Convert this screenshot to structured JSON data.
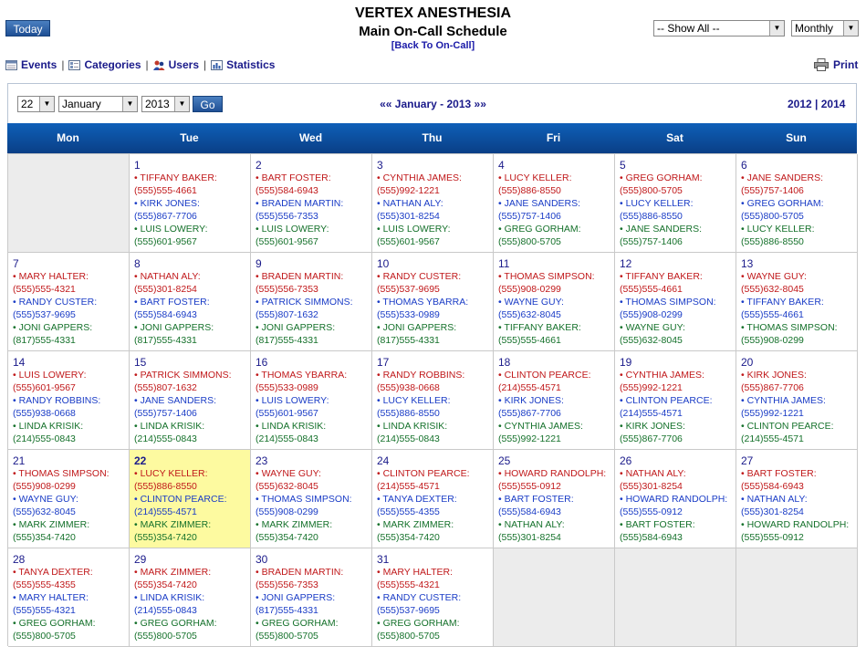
{
  "header": {
    "title": "VERTEX ANESTHESIA",
    "subtitle": "Main On-Call Schedule",
    "back_link": "[Back To On-Call]",
    "today_button": "Today",
    "show_filter": "-- Show All --",
    "view_mode": "Monthly"
  },
  "toolbar": {
    "events": "Events",
    "categories": "Categories",
    "users": "Users",
    "statistics": "Statistics",
    "print": "Print"
  },
  "nav": {
    "day": "22",
    "month": "January",
    "year": "2013",
    "go": "Go",
    "prev": "««",
    "month_label": "January - 2013",
    "next": "»»",
    "prev_year": "2012",
    "year_sep": "|",
    "next_year": "2014"
  },
  "weekdays": [
    "Mon",
    "Tue",
    "Wed",
    "Thu",
    "Fri",
    "Sat",
    "Sun"
  ],
  "colors": {
    "red": "#c0181a",
    "blue": "#1a3cc6",
    "green": "#15712b",
    "header": "#0e5fb8",
    "today": "#fdfaa0"
  },
  "weeks": [
    [
      null,
      {
        "day": "1",
        "entries": [
          [
            "• TIFFANY BAKER:",
            "(555)555-4661"
          ],
          [
            "• KIRK JONES:",
            "(555)867-7706"
          ],
          [
            "• LUIS LOWERY:",
            "(555)601-9567"
          ]
        ]
      },
      {
        "day": "2",
        "entries": [
          [
            "• BART FOSTER:",
            "(555)584-6943"
          ],
          [
            "• BRADEN MARTIN:",
            "(555)556-7353"
          ],
          [
            "• LUIS LOWERY:",
            "(555)601-9567"
          ]
        ]
      },
      {
        "day": "3",
        "entries": [
          [
            "• CYNTHIA JAMES:",
            "(555)992-1221"
          ],
          [
            "• NATHAN ALY:",
            "(555)301-8254"
          ],
          [
            "• LUIS LOWERY:",
            "(555)601-9567"
          ]
        ]
      },
      {
        "day": "4",
        "entries": [
          [
            "• LUCY KELLER:",
            "(555)886-8550"
          ],
          [
            "• JANE SANDERS:",
            "(555)757-1406"
          ],
          [
            "• GREG GORHAM:",
            "(555)800-5705"
          ]
        ]
      },
      {
        "day": "5",
        "entries": [
          [
            "• GREG GORHAM:",
            "(555)800-5705"
          ],
          [
            "• LUCY KELLER:",
            "(555)886-8550"
          ],
          [
            "• JANE SANDERS:",
            "(555)757-1406"
          ]
        ]
      },
      {
        "day": "6",
        "entries": [
          [
            "• JANE SANDERS:",
            "(555)757-1406"
          ],
          [
            "• GREG GORHAM:",
            "(555)800-5705"
          ],
          [
            "• LUCY KELLER:",
            "(555)886-8550"
          ]
        ]
      }
    ],
    [
      {
        "day": "7",
        "entries": [
          [
            "• MARY HALTER:",
            "(555)555-4321"
          ],
          [
            "• RANDY CUSTER:",
            "(555)537-9695"
          ],
          [
            "• JONI GAPPERS:",
            "(817)555-4331"
          ]
        ]
      },
      {
        "day": "8",
        "entries": [
          [
            "• NATHAN ALY:",
            "(555)301-8254"
          ],
          [
            "• BART FOSTER:",
            "(555)584-6943"
          ],
          [
            "• JONI GAPPERS:",
            "(817)555-4331"
          ]
        ]
      },
      {
        "day": "9",
        "entries": [
          [
            "• BRADEN MARTIN:",
            "(555)556-7353"
          ],
          [
            "• PATRICK SIMMONS:",
            "(555)807-1632"
          ],
          [
            "• JONI GAPPERS:",
            "(817)555-4331"
          ]
        ]
      },
      {
        "day": "10",
        "entries": [
          [
            "• RANDY CUSTER:",
            "(555)537-9695"
          ],
          [
            "• THOMAS YBARRA:",
            "(555)533-0989"
          ],
          [
            "• JONI GAPPERS:",
            "(817)555-4331"
          ]
        ]
      },
      {
        "day": "11",
        "entries": [
          [
            "• THOMAS SIMPSON:",
            "(555)908-0299"
          ],
          [
            "• WAYNE GUY:",
            "(555)632-8045"
          ],
          [
            "• TIFFANY BAKER:",
            "(555)555-4661"
          ]
        ]
      },
      {
        "day": "12",
        "entries": [
          [
            "• TIFFANY BAKER:",
            "(555)555-4661"
          ],
          [
            "• THOMAS SIMPSON:",
            "(555)908-0299"
          ],
          [
            "• WAYNE GUY:",
            "(555)632-8045"
          ]
        ]
      },
      {
        "day": "13",
        "entries": [
          [
            "• WAYNE GUY:",
            "(555)632-8045"
          ],
          [
            "• TIFFANY BAKER:",
            "(555)555-4661"
          ],
          [
            "• THOMAS SIMPSON:",
            "(555)908-0299"
          ]
        ]
      }
    ],
    [
      {
        "day": "14",
        "entries": [
          [
            "• LUIS LOWERY:",
            "(555)601-9567"
          ],
          [
            "• RANDY ROBBINS:",
            "(555)938-0668"
          ],
          [
            "• LINDA KRISIK:",
            "(214)555-0843"
          ]
        ]
      },
      {
        "day": "15",
        "entries": [
          [
            "• PATRICK SIMMONS:",
            "(555)807-1632"
          ],
          [
            "• JANE SANDERS:",
            "(555)757-1406"
          ],
          [
            "• LINDA KRISIK:",
            "(214)555-0843"
          ]
        ]
      },
      {
        "day": "16",
        "entries": [
          [
            "• THOMAS YBARRA:",
            "(555)533-0989"
          ],
          [
            "• LUIS LOWERY:",
            "(555)601-9567"
          ],
          [
            "• LINDA KRISIK:",
            "(214)555-0843"
          ]
        ]
      },
      {
        "day": "17",
        "entries": [
          [
            "• RANDY ROBBINS:",
            "(555)938-0668"
          ],
          [
            "• LUCY KELLER:",
            "(555)886-8550"
          ],
          [
            "• LINDA KRISIK:",
            "(214)555-0843"
          ]
        ]
      },
      {
        "day": "18",
        "entries": [
          [
            "• CLINTON PEARCE:",
            "(214)555-4571"
          ],
          [
            "• KIRK JONES:",
            "(555)867-7706"
          ],
          [
            "• CYNTHIA JAMES:",
            "(555)992-1221"
          ]
        ]
      },
      {
        "day": "19",
        "entries": [
          [
            "• CYNTHIA JAMES:",
            "(555)992-1221"
          ],
          [
            "• CLINTON PEARCE:",
            "(214)555-4571"
          ],
          [
            "• KIRK JONES:",
            "(555)867-7706"
          ]
        ]
      },
      {
        "day": "20",
        "entries": [
          [
            "• KIRK JONES:",
            "(555)867-7706"
          ],
          [
            "• CYNTHIA JAMES:",
            "(555)992-1221"
          ],
          [
            "• CLINTON PEARCE:",
            "(214)555-4571"
          ]
        ]
      }
    ],
    [
      {
        "day": "21",
        "entries": [
          [
            "• THOMAS SIMPSON:",
            "(555)908-0299"
          ],
          [
            "• WAYNE GUY:",
            "(555)632-8045"
          ],
          [
            "• MARK ZIMMER:",
            "(555)354-7420"
          ]
        ]
      },
      {
        "day": "22",
        "today": true,
        "entries": [
          [
            "• LUCY KELLER:",
            "(555)886-8550"
          ],
          [
            "• CLINTON PEARCE:",
            "(214)555-4571"
          ],
          [
            "• MARK ZIMMER:",
            "(555)354-7420"
          ]
        ]
      },
      {
        "day": "23",
        "entries": [
          [
            "• WAYNE GUY:",
            "(555)632-8045"
          ],
          [
            "• THOMAS SIMPSON:",
            "(555)908-0299"
          ],
          [
            "• MARK ZIMMER:",
            "(555)354-7420"
          ]
        ]
      },
      {
        "day": "24",
        "entries": [
          [
            "• CLINTON PEARCE:",
            "(214)555-4571"
          ],
          [
            "• TANYA DEXTER:",
            "(555)555-4355"
          ],
          [
            "• MARK ZIMMER:",
            "(555)354-7420"
          ]
        ]
      },
      {
        "day": "25",
        "entries": [
          [
            "• HOWARD RANDOLPH:",
            "(555)555-0912"
          ],
          [
            "• BART FOSTER:",
            "(555)584-6943"
          ],
          [
            "• NATHAN ALY:",
            "(555)301-8254"
          ]
        ]
      },
      {
        "day": "26",
        "entries": [
          [
            "• NATHAN ALY:",
            "(555)301-8254"
          ],
          [
            "• HOWARD RANDOLPH:",
            "(555)555-0912"
          ],
          [
            "• BART FOSTER:",
            "(555)584-6943"
          ]
        ]
      },
      {
        "day": "27",
        "entries": [
          [
            "• BART FOSTER:",
            "(555)584-6943"
          ],
          [
            "• NATHAN ALY:",
            "(555)301-8254"
          ],
          [
            "• HOWARD RANDOLPH:",
            "(555)555-0912"
          ]
        ]
      }
    ],
    [
      {
        "day": "28",
        "entries": [
          [
            "• TANYA DEXTER:",
            "(555)555-4355"
          ],
          [
            "• MARY HALTER:",
            "(555)555-4321"
          ],
          [
            "• GREG GORHAM:",
            "(555)800-5705"
          ]
        ]
      },
      {
        "day": "29",
        "entries": [
          [
            "• MARK ZIMMER:",
            "(555)354-7420"
          ],
          [
            "• LINDA KRISIK:",
            "(214)555-0843"
          ],
          [
            "• GREG GORHAM:",
            "(555)800-5705"
          ]
        ]
      },
      {
        "day": "30",
        "entries": [
          [
            "• BRADEN MARTIN:",
            "(555)556-7353"
          ],
          [
            "• JONI GAPPERS:",
            "(817)555-4331"
          ],
          [
            "• GREG GORHAM:",
            "(555)800-5705"
          ]
        ]
      },
      {
        "day": "31",
        "entries": [
          [
            "• MARY HALTER:",
            "(555)555-4321"
          ],
          [
            "• RANDY CUSTER:",
            "(555)537-9695"
          ],
          [
            "• GREG GORHAM:",
            "(555)800-5705"
          ]
        ]
      },
      null,
      null,
      null
    ]
  ]
}
